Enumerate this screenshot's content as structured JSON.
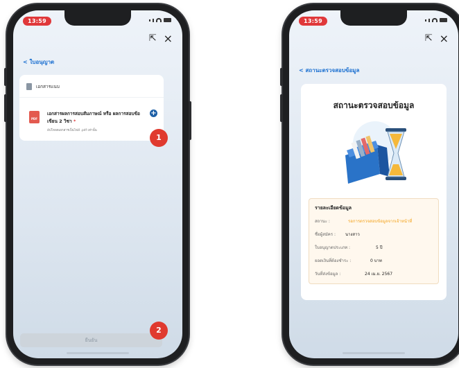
{
  "left_phone": {
    "status_time": "13:59",
    "back_label": "< ใบอนุญาต",
    "documents_header": "เอกสารแนบ",
    "pdf_icon_label": "PDF",
    "required_doc_title": "เอกสารผลการสอบสัมภาษณ์ หรือ ผลการสอบข้อเขียน 2 วิชา",
    "required_star": "*",
    "required_doc_hint": "อัปโหลดเอกสารเป็นไฟล์ .pdf เท่านั้น",
    "add_button_label": "+",
    "badge_1": "1",
    "badge_2": "2",
    "submit_label": "ยืนยัน"
  },
  "right_phone": {
    "status_time": "13:59",
    "back_label": "< สถานะตรวจสอบข้อมูล",
    "card_title": "สถานะตรวจสอบข้อมูล",
    "detail_title": "รายละเอียดข้อมูล",
    "rows": [
      {
        "label": "สถานะ :",
        "value": "รอการตรวจสอบข้อมูลจากเจ้าหน้าที่"
      },
      {
        "label": "ชื่อผู้สมัคร :",
        "value": "นางสาว"
      },
      {
        "label": "ใบอนุญาตประเภท :",
        "value": "5 ปี"
      },
      {
        "label": "ยอดเงินที่ต้องชำระ :",
        "value": "0 บาท"
      },
      {
        "label": "วันที่ส่งข้อมูล :",
        "value": "24 เม.ย. 2567"
      }
    ]
  },
  "colors": {
    "accent": "#1a6fd0",
    "badge": "#e03a2f",
    "status_orange": "#f3a21a",
    "time_pill": "#e0383a"
  }
}
